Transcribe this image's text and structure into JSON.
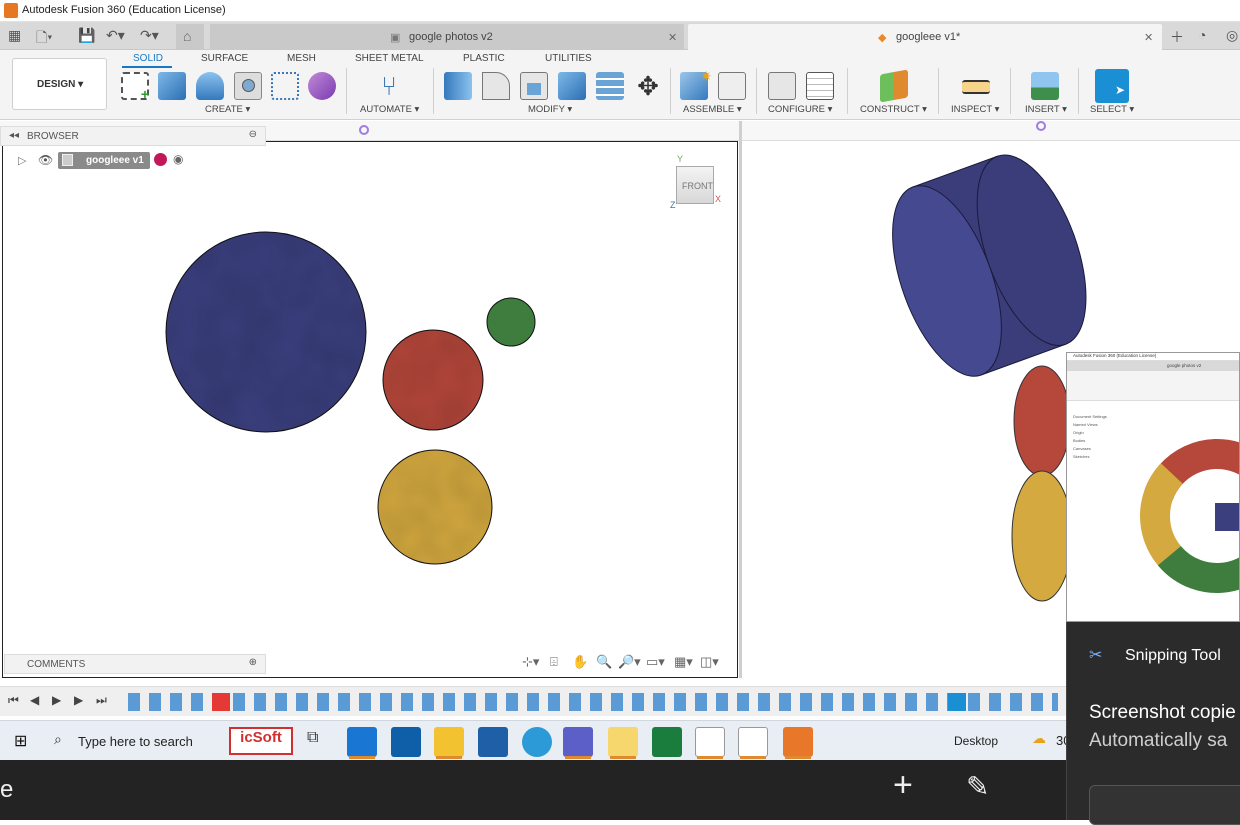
{
  "window": {
    "title": "Autodesk Fusion 360 (Education License)"
  },
  "tabs": [
    {
      "label": "google photos v2",
      "active": false
    },
    {
      "label": "googleee v1*",
      "active": true
    }
  ],
  "workspace": {
    "label": "DESIGN ▾"
  },
  "ribbon_tabs": [
    "SOLID",
    "SURFACE",
    "MESH",
    "SHEET METAL",
    "PLASTIC",
    "UTILITIES"
  ],
  "groups": {
    "create": "CREATE ▾",
    "automate": "AUTOMATE ▾",
    "modify": "MODIFY ▾",
    "assemble": "ASSEMBLE ▾",
    "configure": "CONFIGURE ▾",
    "construct": "CONSTRUCT ▾",
    "inspect": "INSPECT ▾",
    "insert": "INSERT ▾",
    "select": "SELECT ▾"
  },
  "browser": {
    "title": "BROWSER",
    "root_component": "googleee v1"
  },
  "comments": {
    "title": "COMMENTS"
  },
  "viewcube": {
    "face": "FRONT",
    "axis_y": "Y",
    "axis_x": "X",
    "axis_z": "Z"
  },
  "colors": {
    "navy": "#3b3f7e",
    "red": "#b5473b",
    "green": "#3e7d3e",
    "gold": "#d4a93f",
    "accent": "#1a78c2"
  },
  "taskbar": {
    "search_placeholder": "Type here to search",
    "icsoft": "icSoft",
    "desktop": "Desktop",
    "temp": "30"
  },
  "snipping": {
    "app": "Snipping Tool",
    "line1": "Screenshot copie",
    "line2": "Automatically sa"
  },
  "thumbnail": {
    "title": "Autodesk Fusion 360 (Education License)",
    "tab": "google photos v2",
    "items": [
      "Document Settings",
      "Named Views",
      "Origin",
      "Bodies",
      "Canvases",
      "Sketches"
    ]
  },
  "bottom": {
    "left_char": "e"
  }
}
